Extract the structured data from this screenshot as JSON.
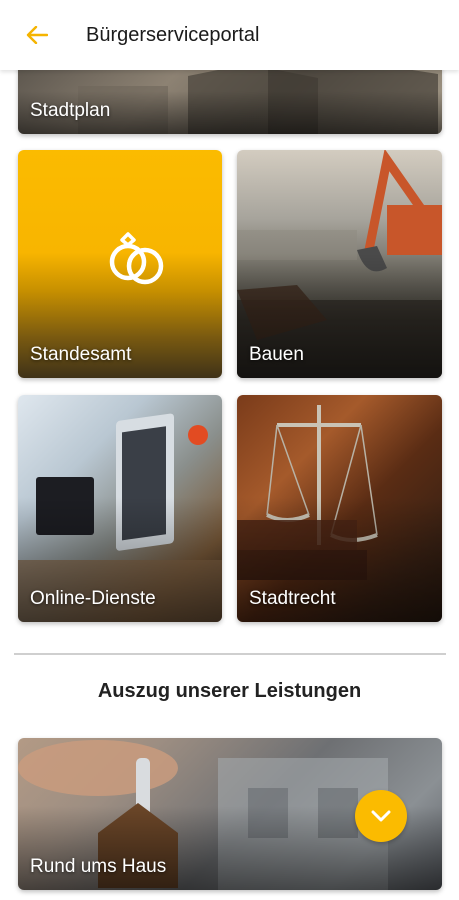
{
  "header": {
    "title": "Bürgerserviceportal",
    "back_icon": "arrow-left-icon",
    "accent": "#fbbb00"
  },
  "tiles": [
    {
      "id": "stadtplan",
      "label": "Stadtplan"
    },
    {
      "id": "standesamt",
      "label": "Standesamt",
      "icon": "wedding-rings-icon"
    },
    {
      "id": "bauen",
      "label": "Bauen"
    },
    {
      "id": "online",
      "label": "Online-Dienste"
    },
    {
      "id": "stadtrecht",
      "label": "Stadtrecht"
    }
  ],
  "section": {
    "title": "Auszug unserer Leistungen"
  },
  "services": [
    {
      "id": "rund-ums-haus",
      "label": "Rund ums Haus",
      "expand_icon": "chevron-down-icon"
    }
  ]
}
